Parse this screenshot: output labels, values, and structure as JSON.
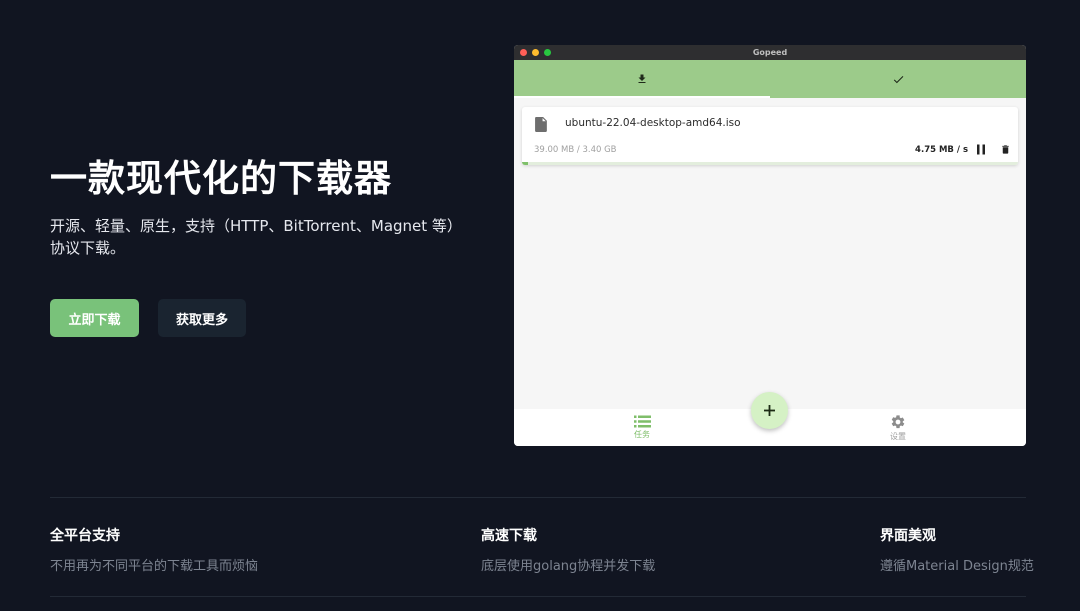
{
  "hero": {
    "title": "一款现代化的下载器",
    "description": "开源、轻量、原生，支持（HTTP、BitTorrent、Magnet 等）协议下载。",
    "primary_button": "立即下载",
    "secondary_button": "获取更多"
  },
  "window": {
    "title": "Gopeed",
    "tabs": [
      {
        "icon": "download-icon",
        "active": true
      },
      {
        "icon": "check-icon",
        "active": false
      }
    ],
    "task": {
      "file_name": "ubuntu-22.04-desktop-amd64.iso",
      "size_progress": "39.00 MB / 3.40 GB",
      "speed": "4.75 MB / s",
      "progress_fraction": 0.0115
    },
    "nav": [
      {
        "label": "任务",
        "icon": "list-icon",
        "active": true
      },
      {
        "label": "设置",
        "icon": "gear-icon",
        "active": false
      }
    ],
    "fab_icon": "plus-icon"
  },
  "features": [
    {
      "title": "全平台支持",
      "description": "不用再为不同平台的下载工具而烦恼"
    },
    {
      "title": "高速下载",
      "description": "底层使用golang协程并发下载"
    },
    {
      "title": "界面美观",
      "description": "遵循Material Design规范"
    }
  ],
  "colors": {
    "background": "#111521",
    "accent": "#79c27a",
    "tabbar": "#9ccb8a",
    "fab": "#d5f1c5"
  }
}
